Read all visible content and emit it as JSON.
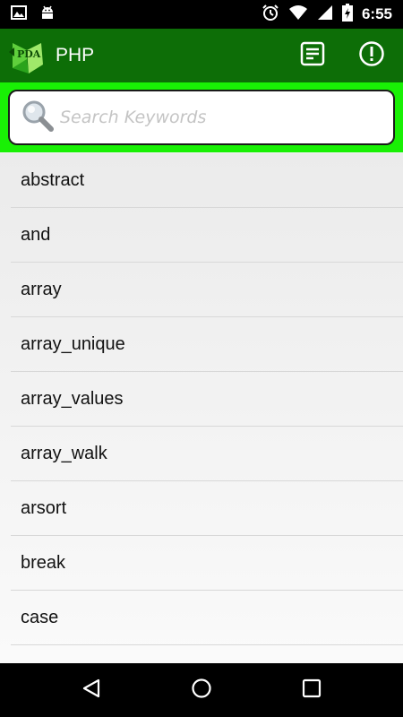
{
  "status_bar": {
    "time": "6:55"
  },
  "app_bar": {
    "title": "PHP",
    "logo_text": "PDA"
  },
  "search": {
    "placeholder": "Search Keywords",
    "value": ""
  },
  "keywords": [
    "abstract",
    "and",
    "array",
    "array_unique",
    "array_values",
    "array_walk",
    "arsort",
    "break",
    "case"
  ],
  "colors": {
    "app_bar": "#0d6e07",
    "search_area": "#19f005",
    "status_bar": "#000000",
    "nav_bar": "#000000"
  },
  "icons": {
    "status_left": [
      "image-icon",
      "android-icon"
    ],
    "status_right": [
      "alarm-icon",
      "wifi-icon",
      "signal-icon",
      "battery-icon"
    ],
    "app_actions": [
      "notes-icon",
      "info-icon"
    ],
    "nav": [
      "back-icon",
      "home-icon",
      "recents-icon"
    ]
  }
}
